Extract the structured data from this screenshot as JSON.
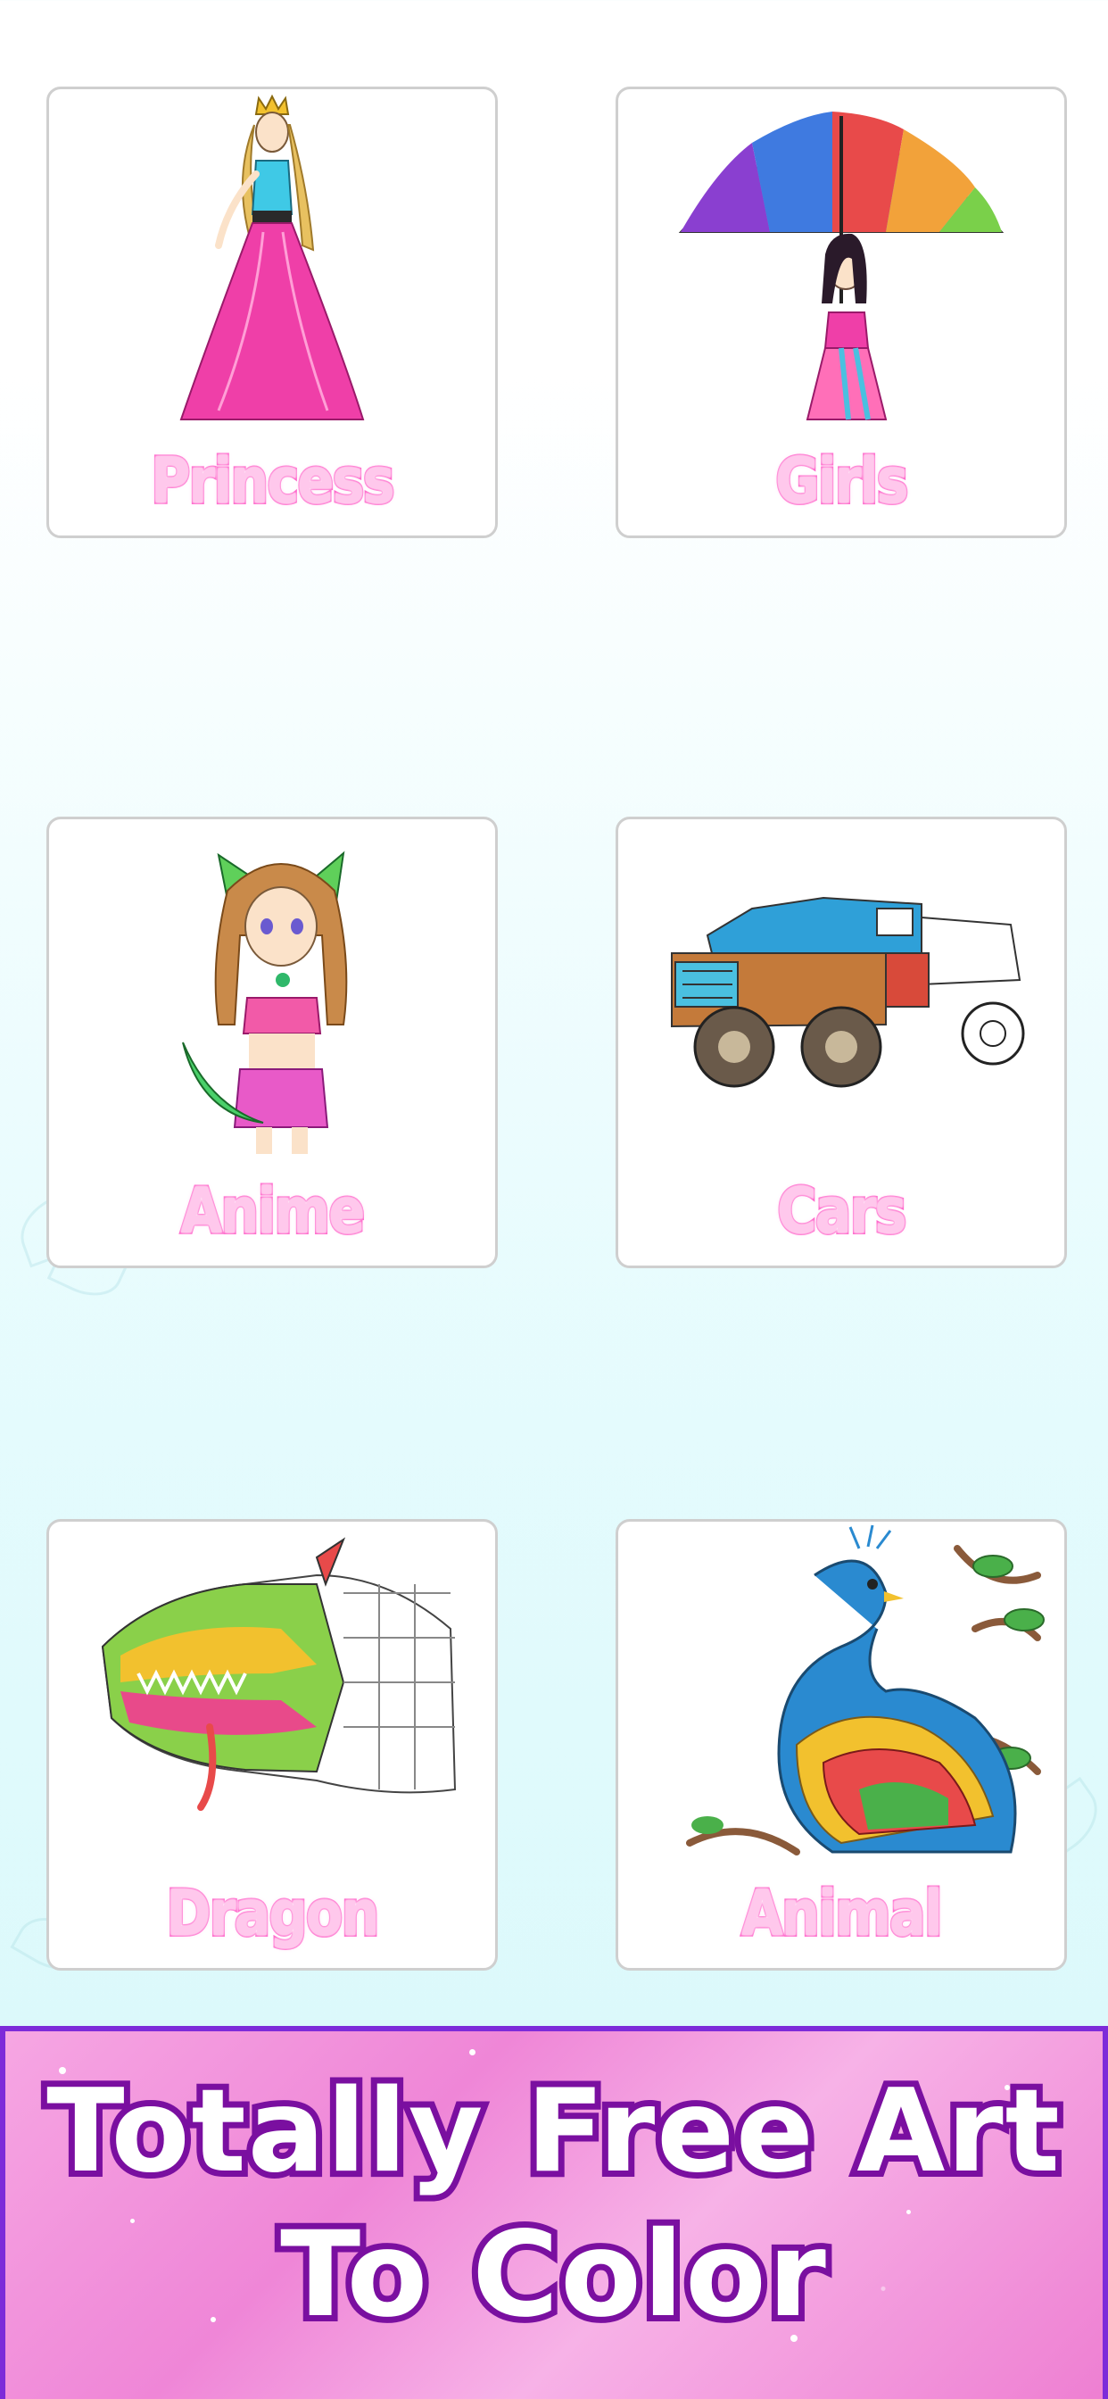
{
  "categories": [
    {
      "label": "Princess",
      "icon": "princess-illustration"
    },
    {
      "label": "Girls",
      "icon": "girl-umbrella-illustration"
    },
    {
      "label": "Anime",
      "icon": "anime-girl-illustration"
    },
    {
      "label": "Cars",
      "icon": "truck-illustration"
    },
    {
      "label": "Dragon",
      "icon": "dragon-illustration"
    },
    {
      "label": "Animal",
      "icon": "peacock-illustration"
    }
  ],
  "banner": {
    "line1": "Totally Free Art",
    "line2": "To Color"
  },
  "colors": {
    "label_fill": "#ffc8ec",
    "label_stroke": "#ff5fc8",
    "banner_border": "#7d2bd9",
    "banner_text_stroke": "#7a0fa0",
    "banner_glitter": "#ef86d7"
  }
}
